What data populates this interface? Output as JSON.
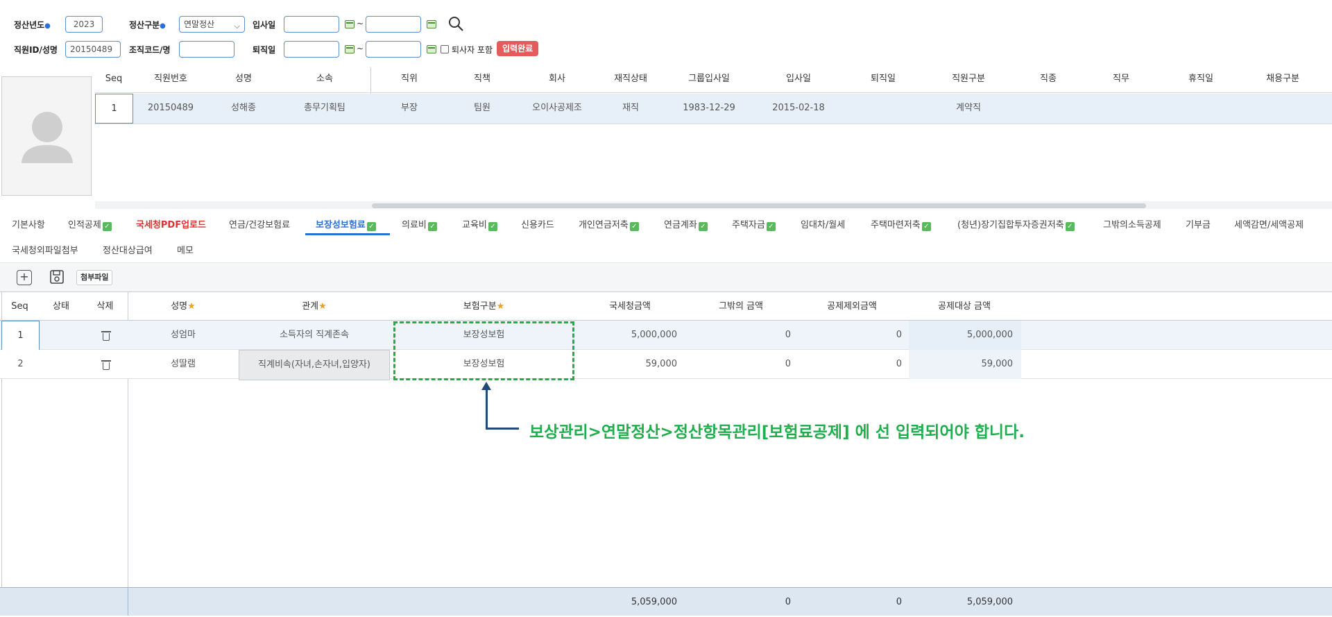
{
  "search": {
    "year_label": "정산년도",
    "year_value": "2023",
    "type_label": "정산구분",
    "type_value": "연말정산",
    "hire_label": "입사일",
    "emp_label": "직원ID/성명",
    "emp_value": "20150489",
    "org_label": "조직코드/명",
    "retire_label": "퇴직일",
    "tilde": "~",
    "include_retired_label": "퇴사자 포함",
    "complete_badge": "입력완료"
  },
  "employee_grid": {
    "columns": [
      "Seq",
      "직원번호",
      "성명",
      "소속",
      "직위",
      "직책",
      "회사",
      "재직상태",
      "그룹입사일",
      "입사일",
      "퇴직일",
      "직원구분",
      "직종",
      "직무",
      "휴직일",
      "채용구분"
    ],
    "row": {
      "seq": "1",
      "emp_no": "20150489",
      "name": "성해종",
      "dept": "총무기획팀",
      "position": "부장",
      "duty": "팀원",
      "company": "오이사공제조",
      "status": "재직",
      "group_join": "1983-12-29",
      "join": "2015-02-18",
      "retire": "",
      "emp_type": "계약직"
    }
  },
  "tabs": {
    "row1": [
      "기본사항",
      "인적공제",
      "국세청PDF업로드",
      "연금/건강보험료",
      "보장성보험료",
      "의료비",
      "교육비",
      "신용카드",
      "개인연금저축",
      "연금계좌",
      "주택자금",
      "임대차/월세",
      "주택마련저축",
      "(청년)장기집합투자증권저축",
      "그밖의소득공제",
      "기부금",
      "세액감면/세액공제"
    ],
    "row2": [
      "국세청외파일첨부",
      "정산대상급여",
      "메모"
    ]
  },
  "toolbar": {
    "add_icon": "plus-square-icon",
    "save_icon": "save-icon",
    "attach_label": "첨부파일"
  },
  "detail_grid": {
    "columns": {
      "seq": "Seq",
      "status": "상태",
      "delete": "삭제",
      "name": "성명",
      "relation": "관계",
      "insurance_type": "보험구분",
      "nts_amount": "국세청금액",
      "other_amount": "그밖의 금액",
      "excluded_amount": "공제제외금액",
      "target_amount": "공제대상 금액"
    },
    "rows": [
      {
        "seq": "1",
        "name": "성엄마",
        "relation": "소득자의 직계존속",
        "insurance_type": "보장성보험",
        "nts_amount": "5,000,000",
        "other_amount": "0",
        "excluded_amount": "0",
        "target_amount": "5,000,000"
      },
      {
        "seq": "2",
        "name": "성딸램",
        "relation": "직계비속(자녀,손자녀,입양자)",
        "insurance_type": "보장성보험",
        "nts_amount": "59,000",
        "other_amount": "0",
        "excluded_amount": "0",
        "target_amount": "59,000"
      }
    ],
    "totals": {
      "nts_amount": "5,059,000",
      "other_amount": "0",
      "excluded_amount": "0",
      "target_amount": "5,059,000"
    }
  },
  "annotation": {
    "text": "보상관리>연말정산>정산항목관리[보험료공제] 에 선 입력되어야 합니다."
  },
  "colors": {
    "accent": "#2b6fd6",
    "note_green": "#1fae4b",
    "badge_red": "#e35b5b"
  }
}
